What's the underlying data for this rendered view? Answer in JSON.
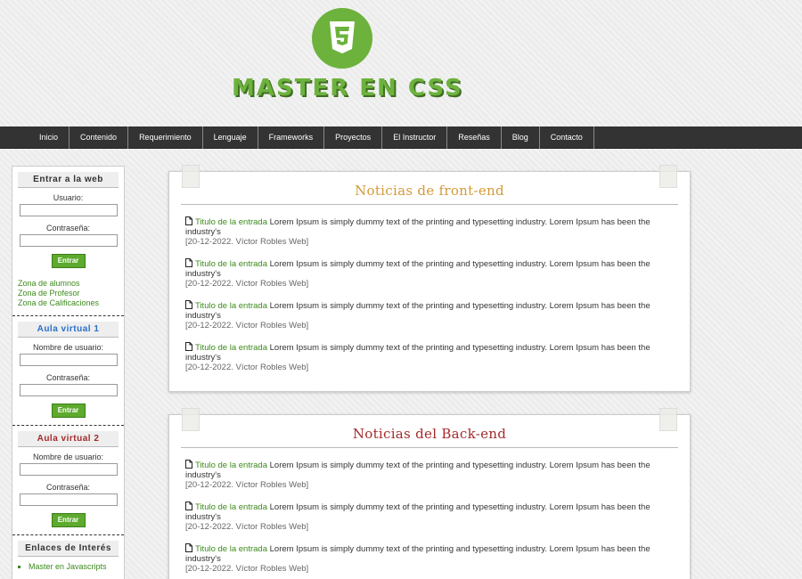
{
  "brand": {
    "title": "MASTER EN CSS",
    "accent": "#6cb23d"
  },
  "nav": [
    "Inicio",
    "Contenido",
    "Requerimiento",
    "Lenguaje",
    "Frameworks",
    "Proyectos",
    "El Instructor",
    "Reseñas",
    "Blog",
    "Contacto"
  ],
  "login": {
    "title": "Entrar a la web",
    "user_label": "Usuario:",
    "pass_label": "Contraseña:",
    "button": "Entrar",
    "links": [
      "Zona de alumnos",
      "Zona de Profesor",
      "Zona de Calificaciones"
    ]
  },
  "aula1": {
    "title": "Aula virtual 1",
    "user_label": "Nombre de usuario:",
    "pass_label": "Contraseña:",
    "button": "Entrar"
  },
  "aula2": {
    "title": "Aula virtual 2",
    "user_label": "Nombre de usuario:",
    "pass_label": "Contraseña:",
    "button": "Entrar"
  },
  "links_box": {
    "title": "Enlaces de Interés",
    "items": [
      "Master en Javascripts"
    ]
  },
  "front": {
    "title": "Noticias de front-end",
    "items": [
      {
        "link": "Titulo de la entrada",
        "text": "Lorem Ipsum is simply dummy text of the printing and typesetting industry. Lorem Ipsum has been the industry's",
        "meta": "[20-12-2022. Víctor Robles Web]"
      },
      {
        "link": "Titulo de la entrada",
        "text": "Lorem Ipsum is simply dummy text of the printing and typesetting industry. Lorem Ipsum has been the industry's",
        "meta": "[20-12-2022. Víctor Robles Web]"
      },
      {
        "link": "Titulo de la entrada",
        "text": "Lorem Ipsum is simply dummy text of the printing and typesetting industry. Lorem Ipsum has been the industry's",
        "meta": "[20-12-2022. Víctor Robles Web]"
      },
      {
        "link": "Titulo de la entrada",
        "text": "Lorem Ipsum is simply dummy text of the printing and typesetting industry. Lorem Ipsum has been the industry's",
        "meta": "[20-12-2022. Víctor Robles Web]"
      }
    ]
  },
  "back": {
    "title": "Noticias del Back-end",
    "items": [
      {
        "link": "Titulo de la entrada",
        "text": "Lorem Ipsum is simply dummy text of the printing and typesetting industry. Lorem Ipsum has been the industry's",
        "meta": "[20-12-2022. Víctor Robles Web]"
      },
      {
        "link": "Titulo de la entrada",
        "text": "Lorem Ipsum is simply dummy text of the printing and typesetting industry. Lorem Ipsum has been the industry's",
        "meta": "[20-12-2022. Víctor Robles Web]"
      },
      {
        "link": "Titulo de la entrada",
        "text": "Lorem Ipsum is simply dummy text of the printing and typesetting industry. Lorem Ipsum has been the industry's",
        "meta": "[20-12-2022. Víctor Robles Web]"
      }
    ]
  }
}
